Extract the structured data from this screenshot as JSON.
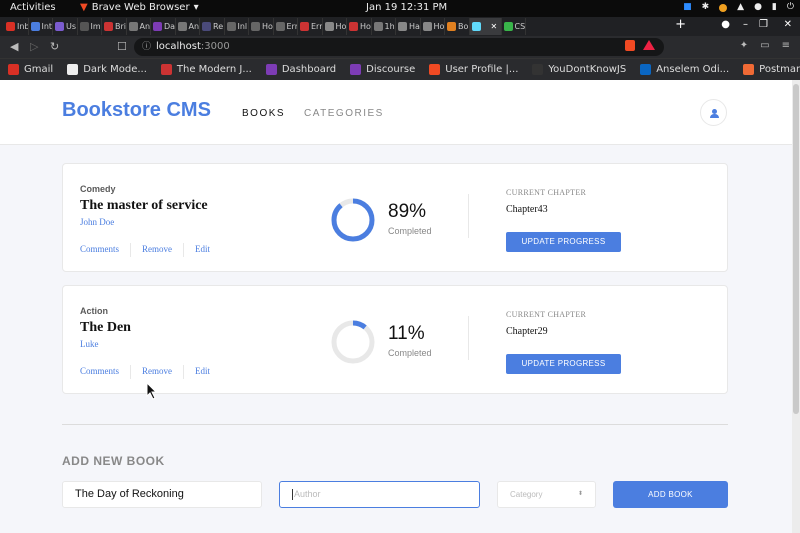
{
  "os_bar": {
    "activities": "Activities",
    "app_name": "Brave Web Browser",
    "clock": "Jan 19  12:31 PM"
  },
  "browser": {
    "tabs": [
      {
        "label": "Inb",
        "color": "#d93025"
      },
      {
        "label": "Int",
        "color": "#4b7ee0"
      },
      {
        "label": "Us",
        "color": "#7b5ccf"
      },
      {
        "label": "Im",
        "color": "#555"
      },
      {
        "label": "Bri",
        "color": "#c33"
      },
      {
        "label": "An",
        "color": "#777"
      },
      {
        "label": "Da",
        "color": "#7d3cb5"
      },
      {
        "label": "An",
        "color": "#777"
      },
      {
        "label": "Re",
        "color": "#4a4a7a"
      },
      {
        "label": "Inl",
        "color": "#666"
      },
      {
        "label": "Ho",
        "color": "#666"
      },
      {
        "label": "Err",
        "color": "#666"
      },
      {
        "label": "Err",
        "color": "#c33"
      },
      {
        "label": "Ho",
        "color": "#888"
      },
      {
        "label": "Ho",
        "color": "#c33"
      },
      {
        "label": "1h",
        "color": "#777"
      },
      {
        "label": "Ha",
        "color": "#888"
      },
      {
        "label": "Ho",
        "color": "#888"
      },
      {
        "label": "Bo",
        "color": "#e08020"
      },
      {
        "label": "",
        "color": "#61dafb",
        "active": true
      },
      {
        "label": "CS",
        "color": "#39b54a"
      }
    ],
    "url_host": "localhost",
    "url_port": ":3000",
    "bookmarks": [
      {
        "label": "Gmail",
        "color": "#d93025"
      },
      {
        "label": "Dark Mode...",
        "color": "#eee"
      },
      {
        "label": "The Modern J...",
        "color": "#c33"
      },
      {
        "label": "Dashboard",
        "color": "#7d3cb5"
      },
      {
        "label": "Discourse",
        "color": "#7d3cb5"
      },
      {
        "label": "User Profile |...",
        "color": "#f04a23"
      },
      {
        "label": "YouDontKnowJS",
        "color": "#333"
      },
      {
        "label": "Anselem Odi...",
        "color": "#0a66c2"
      },
      {
        "label": "Postman",
        "color": "#f06a35"
      }
    ]
  },
  "app": {
    "logo": "Bookstore CMS",
    "nav": {
      "books": "BOOKS",
      "categories": "CATEGORIES"
    },
    "books": [
      {
        "genre": "Comedy",
        "title": "The master of service",
        "author": "John Doe",
        "progress": 89,
        "percent_label": "89%",
        "completed_label": "Completed",
        "chapter_label": "CURRENT CHAPTER",
        "chapter": "Chapter43",
        "actions": [
          "Comments",
          "Remove",
          "Edit"
        ],
        "button": "UPDATE PROGRESS"
      },
      {
        "genre": "Action",
        "title": "The Den",
        "author": "Luke",
        "progress": 11,
        "percent_label": "11%",
        "completed_label": "Completed",
        "chapter_label": "CURRENT CHAPTER",
        "chapter": "Chapter29",
        "actions": [
          "Comments",
          "Remove",
          "Edit"
        ],
        "button": "UPDATE PROGRESS"
      }
    ],
    "add_form": {
      "heading": "ADD NEW BOOK",
      "title_value": "The Day of Reckoning",
      "author_placeholder": "Author",
      "category_placeholder": "Category",
      "button": "ADD BOOK"
    },
    "colors": {
      "accent": "#4b7ee0",
      "track": "#e8e8e8"
    }
  }
}
